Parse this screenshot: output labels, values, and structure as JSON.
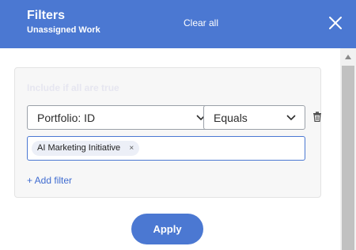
{
  "header": {
    "title": "Filters",
    "subtitle": "Unassigned Work",
    "clear_all_label": "Clear all",
    "close_icon": "close-icon"
  },
  "filter_group": {
    "match_label": "Include if all are true",
    "filters": [
      {
        "field": "Portfolio: ID",
        "operator": "Equals",
        "values": [
          "AI Marketing Initiative"
        ]
      }
    ],
    "add_filter_label": "+ Add filter"
  },
  "apply_label": "Apply",
  "colors": {
    "accent": "#4b78d2",
    "link": "#3f6bd0",
    "panel_bg": "#f7f7f7"
  },
  "icons": [
    "close-icon",
    "chevron-down-icon",
    "trash-icon",
    "remove-chip-icon",
    "scroll-up-arrow-icon"
  ]
}
